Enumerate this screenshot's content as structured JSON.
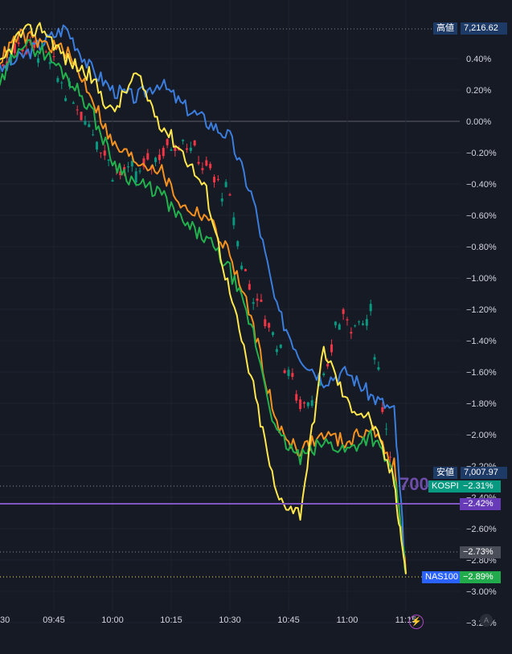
{
  "chart_data": {
    "type": "line",
    "x_ticks": [
      "30",
      "09:45",
      "10:00",
      "10:15",
      "10:30",
      "10:45",
      "11:00",
      "11:15"
    ],
    "y_ticks": [
      "0.40%",
      "0.20%",
      "0.00%",
      "−0.20%",
      "−0.40%",
      "−0.60%",
      "−0.80%",
      "−1.00%",
      "−1.20%",
      "−1.40%",
      "−1.60%",
      "−1.80%",
      "−2.00%",
      "−2.20%",
      "−2.40%",
      "−2.60%",
      "−2.80%",
      "−3.00%",
      "−3.20%"
    ],
    "ylim": [
      -3.2,
      0.4
    ],
    "grid": true,
    "high_label": "高値",
    "high_value": "7,216.62",
    "low_label": "安値",
    "low_value": "7,007.97",
    "series": [
      {
        "name": "KOSPI",
        "color": "#089981",
        "last": "−2.31%"
      },
      {
        "name": "NAS100",
        "color": "#2962ff",
        "last": "−2.89%"
      }
    ],
    "tags": {
      "purple_line": "−2.42%",
      "grey_line": "−2.73%"
    },
    "watermark": "700",
    "overlay_candles": "KOSPI",
    "comparison_lines": [
      {
        "color": "#3b7ddd",
        "x": [
          9.5,
          9.6,
          9.7,
          9.8,
          9.9,
          10.0,
          10.1,
          10.2,
          10.3,
          10.4,
          10.5,
          10.6,
          10.7,
          10.8,
          10.9,
          11.0,
          11.1,
          11.2,
          11.25
        ],
        "y": [
          0.3,
          0.4,
          0.5,
          0.6,
          0.35,
          0.2,
          0.15,
          0.25,
          0.1,
          0.0,
          -0.1,
          -0.5,
          -1.2,
          -1.5,
          -1.65,
          -1.6,
          -1.75,
          -1.85,
          -2.89
        ]
      },
      {
        "color": "#f5911e",
        "x": [
          9.5,
          9.6,
          9.7,
          9.8,
          9.9,
          10.0,
          10.1,
          10.2,
          10.3,
          10.4,
          10.5,
          10.6,
          10.7,
          10.8,
          10.9,
          11.0,
          11.1,
          11.2,
          11.25
        ],
        "y": [
          0.35,
          0.55,
          0.5,
          0.45,
          0.2,
          -0.15,
          -0.25,
          -0.3,
          -0.55,
          -0.6,
          -0.85,
          -1.3,
          -1.95,
          -2.1,
          -2.0,
          -2.05,
          -1.95,
          -2.2,
          -2.89
        ]
      },
      {
        "color": "#22b14c",
        "x": [
          9.5,
          9.6,
          9.7,
          9.8,
          9.9,
          10.0,
          10.1,
          10.2,
          10.3,
          10.4,
          10.5,
          10.6,
          10.7,
          10.8,
          10.9,
          11.0,
          11.1,
          11.2,
          11.25
        ],
        "y": [
          0.15,
          0.5,
          0.45,
          0.3,
          0.1,
          -0.25,
          -0.4,
          -0.45,
          -0.65,
          -0.75,
          -0.95,
          -1.35,
          -2.0,
          -2.15,
          -2.05,
          -2.1,
          -2.0,
          -2.25,
          -2.89
        ]
      },
      {
        "color": "#ffe74c",
        "x": [
          9.5,
          9.6,
          9.7,
          9.8,
          9.9,
          10.0,
          10.1,
          10.2,
          10.3,
          10.4,
          10.5,
          10.6,
          10.7,
          10.8,
          10.9,
          11.0,
          11.1,
          11.2,
          11.25
        ],
        "y": [
          0.3,
          0.55,
          0.6,
          0.4,
          0.3,
          0.05,
          0.3,
          0.0,
          -0.2,
          -0.45,
          -1.1,
          -1.7,
          -2.4,
          -2.5,
          -1.45,
          -1.8,
          -1.9,
          -2.3,
          -2.89
        ]
      }
    ]
  }
}
